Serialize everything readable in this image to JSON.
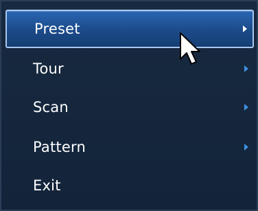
{
  "menu": {
    "items": [
      {
        "label": "Preset",
        "has_submenu": true,
        "selected": true
      },
      {
        "label": "Tour",
        "has_submenu": true,
        "selected": false
      },
      {
        "label": "Scan",
        "has_submenu": true,
        "selected": false
      },
      {
        "label": "Pattern",
        "has_submenu": true,
        "selected": false
      },
      {
        "label": "Exit",
        "has_submenu": false,
        "selected": false
      }
    ]
  },
  "icons": {
    "submenu_arrow": "chevron-right-icon",
    "pointer": "mouse-cursor-icon"
  },
  "colors": {
    "selected_bg": "#1b4a88",
    "menu_bg": "#182a40",
    "arrow": "#3f8fe0",
    "text": "#ffffff"
  }
}
